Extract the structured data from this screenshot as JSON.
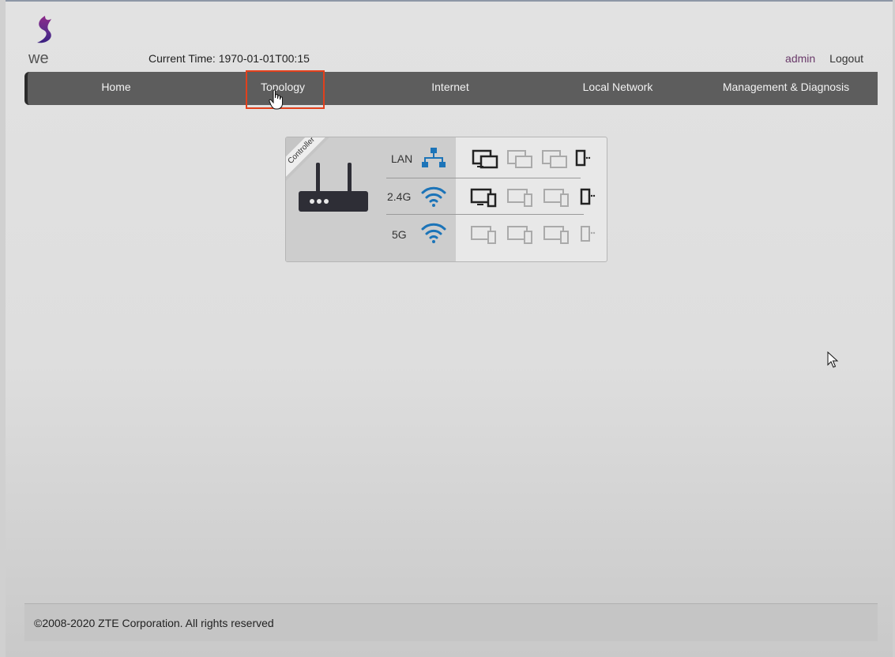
{
  "header": {
    "logo_text": "we",
    "current_time": "Current Time: 1970-01-01T00:15",
    "user": "admin",
    "logout": "Logout"
  },
  "nav": {
    "items": [
      {
        "label": "Home"
      },
      {
        "label": "Topology",
        "active": true
      },
      {
        "label": "Internet"
      },
      {
        "label": "Local Network"
      },
      {
        "label": "Management & Diagnosis"
      }
    ]
  },
  "topology": {
    "controller_label": "Controller",
    "bands": [
      {
        "label": "LAN",
        "icon": "lan-network-icon"
      },
      {
        "label": "2.4G",
        "icon": "wifi-icon"
      },
      {
        "label": "5G",
        "icon": "wifi-icon"
      }
    ]
  },
  "footer": {
    "copyright": "©2008-2020 ZTE Corporation. All rights reserved"
  },
  "colors": {
    "nav_bg": "#5d5d5d",
    "highlight": "#e2401c",
    "icon_blue": "#1c74b8",
    "link_purple": "#6a3a6a"
  }
}
